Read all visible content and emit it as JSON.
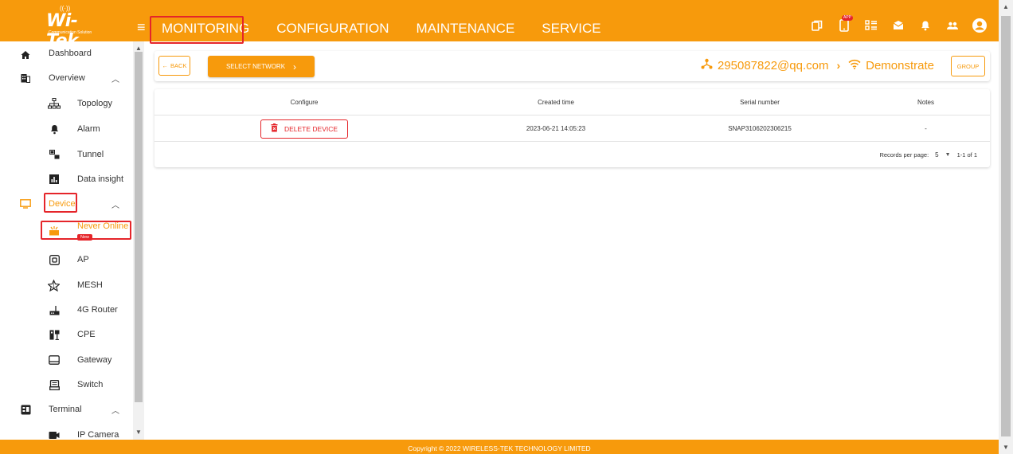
{
  "brand": {
    "logo_text": "Wi-Tek",
    "logo_sub": "Communication Solution"
  },
  "nav": {
    "items": [
      {
        "label": "MONITORING"
      },
      {
        "label": "CONFIGURATION"
      },
      {
        "label": "MAINTENANCE"
      },
      {
        "label": "SERVICE"
      }
    ],
    "active": "MONITORING",
    "app_badge": "APP"
  },
  "sidebar": {
    "dashboard": "Dashboard",
    "overview": "Overview",
    "topology": "Topology",
    "alarm": "Alarm",
    "tunnel": "Tunnel",
    "data_insight": "Data insight",
    "device": "Device",
    "never_online": "Never Online",
    "new_badge": "New",
    "ap": "AP",
    "mesh": "MESH",
    "router_4g": "4G Router",
    "cpe": "CPE",
    "gateway": "Gateway",
    "switch": "Switch",
    "terminal": "Terminal",
    "ip_camera": "IP Camera"
  },
  "toolbar": {
    "back_label": "BACK",
    "select_network_label": "SELECT NETWORK",
    "account": "295087822@qq.com",
    "network": "Demonstrate",
    "group_label": "GROUP"
  },
  "table": {
    "headers": [
      "Configure",
      "Created time",
      "Serial number",
      "Notes"
    ],
    "rows": [
      {
        "action_label": "DELETE DEVICE",
        "created_time": "2023-06-21 14:05:23",
        "serial": "SNAP3106202306215",
        "notes": "-"
      }
    ],
    "pagination": {
      "records_label": "Records per page:",
      "per_page": "5",
      "range": "1-1 of 1"
    }
  },
  "footer": {
    "copyright": "Copyright © 2022 WIRELESS-TEK TECHNOLOGY LIMITED"
  },
  "colors": {
    "brand_orange": "#f79a0c",
    "alert_red": "#e5252a"
  }
}
